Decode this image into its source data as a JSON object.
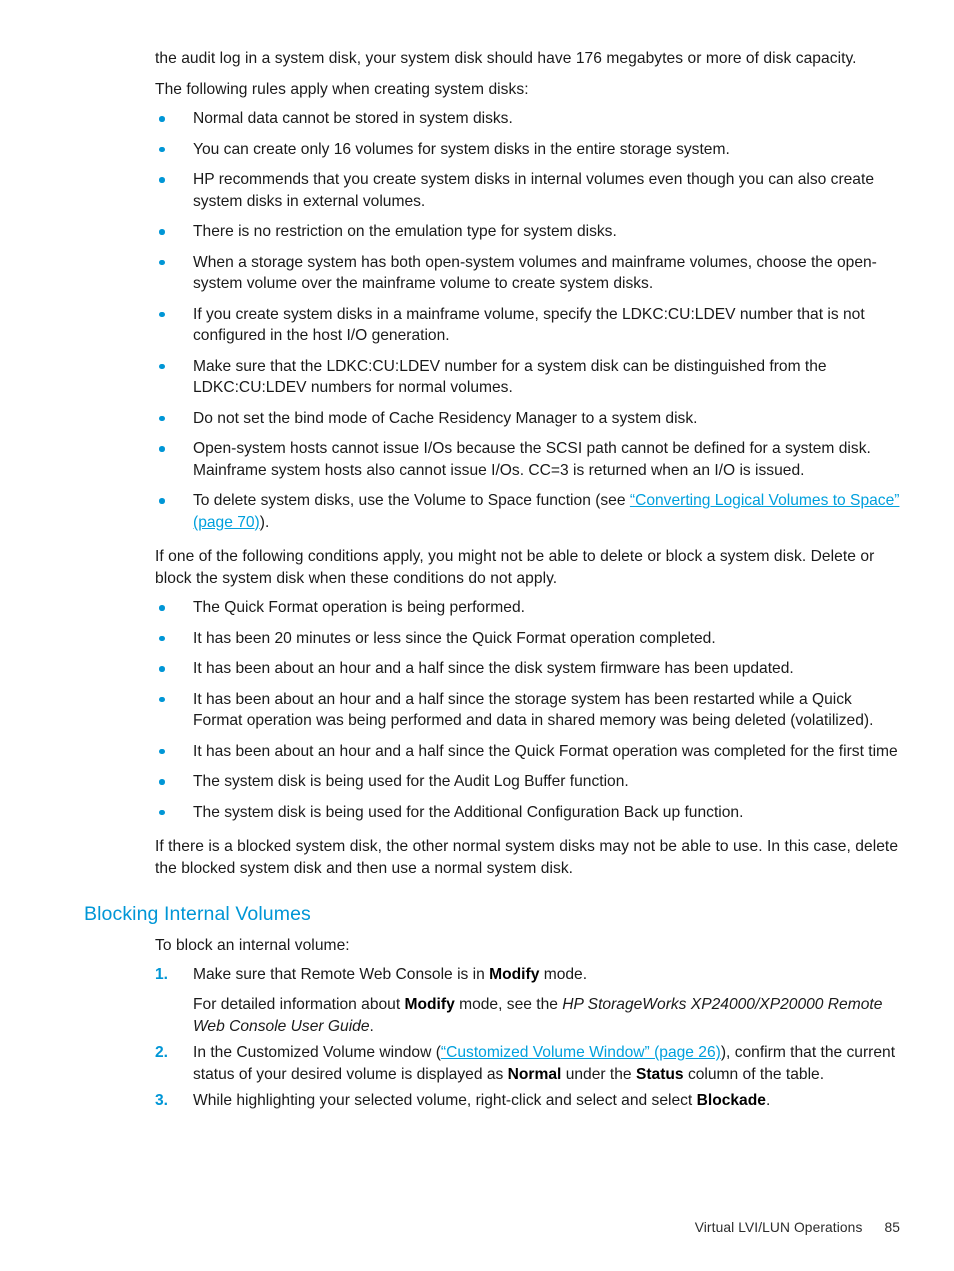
{
  "page": {
    "intro_paragraphs": [
      "the audit log in a system disk, your system disk should have 176 megabytes or more of disk capacity.",
      "The following rules apply when creating system disks:"
    ],
    "rules_bullets": [
      "Normal data cannot be stored in system disks.",
      "You can create only 16 volumes for system disks in the entire storage system.",
      "HP recommends that you create system disks in internal volumes even though you can also create system disks in external volumes.",
      "There is no restriction on the emulation type for system disks.",
      "When a storage system has both open-system volumes and mainframe volumes, choose the open-system volume over the mainframe volume to create system disks.",
      "If you create system disks in a mainframe volume, specify the LDKC:CU:LDEV number that is not configured in the host I/O generation.",
      "Make sure that the LDKC:CU:LDEV number for a system disk can be distinguished from the LDKC:CU:LDEV numbers for normal volumes.",
      "Do not set the bind mode of Cache Residency Manager to a system disk.",
      "Open-system hosts cannot issue I/Os because the SCSI path cannot be defined for a system disk. Mainframe system hosts also cannot issue I/Os. CC=3 is returned when an I/O is issued."
    ],
    "delete_bullet": {
      "before_link": "To delete system disks, use the Volume to Space function (see ",
      "link_text": "“Converting Logical Volumes to Space” (page 70)",
      "after_link": ")."
    },
    "conditions_intro": "If one of the following conditions apply, you might not be able to delete or block a system disk. Delete or block the system disk when these conditions do not apply.",
    "conditions_bullets": [
      "The Quick Format operation is being performed.",
      "It has been 20 minutes or less since the Quick Format operation completed.",
      "It has been about an hour and a half since the disk system firmware has been updated.",
      "It has been about an hour and a half since the storage system has been restarted while a Quick Format operation was being performed and data in shared memory was being deleted (volatilized).",
      "It has been about an hour and a half since the Quick Format operation was completed for the first time",
      "The system disk is being used for the Audit Log Buffer function.",
      "The system disk is being used for the Additional Configuration Back up function."
    ],
    "blocked_disk_note": "If there is a blocked system disk, the other normal system disks may not be able to use. In this case, delete the blocked system disk and then use a normal system disk.",
    "section": {
      "heading": "Blocking Internal Volumes",
      "intro": "To block an internal volume:",
      "steps": [
        {
          "number": "1.",
          "part1": "Make sure that Remote Web Console is in ",
          "bold1": "Modify",
          "part2": " mode.",
          "sub_part1": "For detailed information about ",
          "sub_bold1": "Modify",
          "sub_part2": " mode, see the ",
          "sub_italic": "HP StorageWorks XP24000/XP20000 Remote Web Console User Guide",
          "sub_part3": "."
        },
        {
          "number": "2.",
          "part1": "In the Customized Volume window (",
          "link": "“Customized Volume Window” (page 26)",
          "part2": "), confirm that the current status of your desired volume is displayed as ",
          "bold1": "Normal",
          "part3": " under the ",
          "bold2": "Status",
          "part4": " column of the table."
        },
        {
          "number": "3.",
          "part1": "While highlighting your selected volume, right-click and select and select ",
          "bold1": "Blockade",
          "part2": "."
        }
      ]
    },
    "footer": {
      "title": "Virtual LVI/LUN Operations",
      "page_number": "85"
    },
    "colors": {
      "accent_blue": "#0096d6",
      "link_blue": "#00a0dd",
      "body_text": "#1a1a1a"
    }
  }
}
